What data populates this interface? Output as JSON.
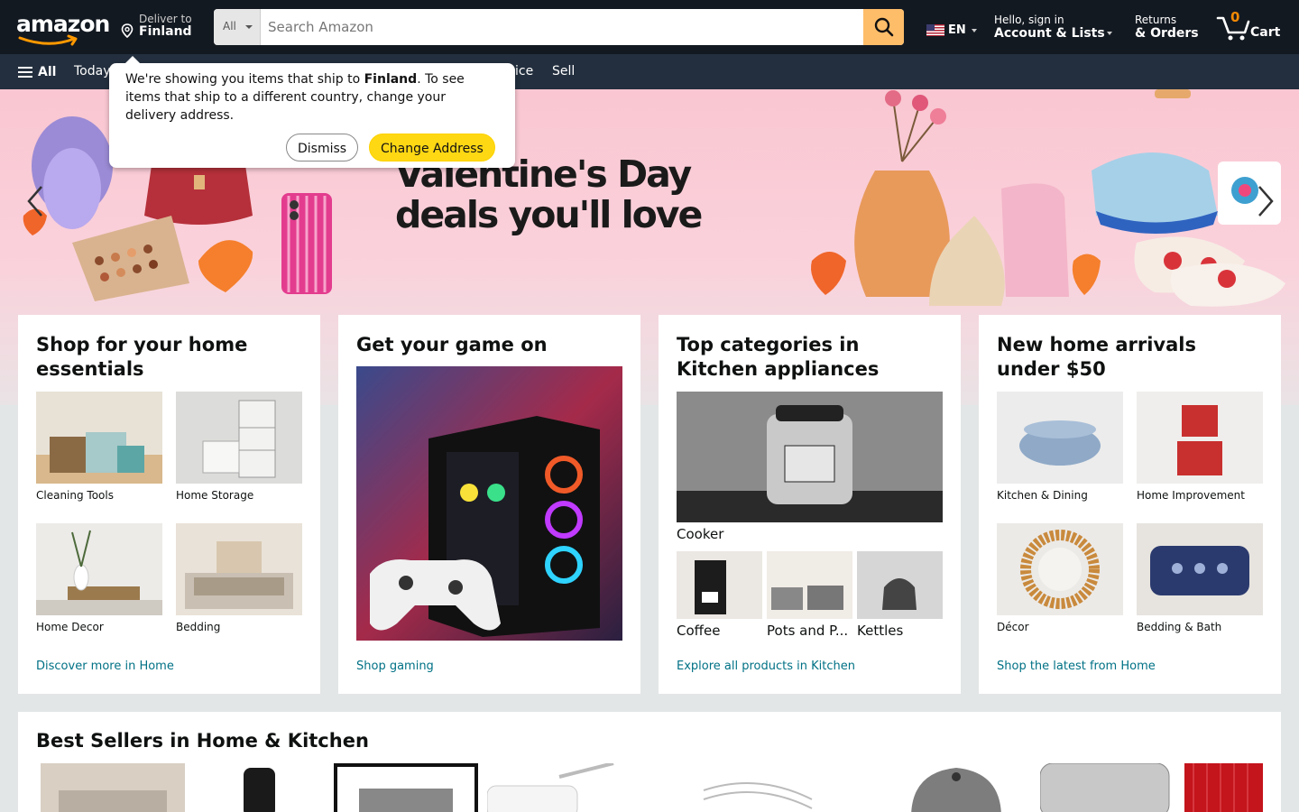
{
  "header": {
    "logo_text": "amazon",
    "deliver_line1": "Deliver to",
    "deliver_line2": "Finland",
    "search_category": "All",
    "search_placeholder": "Search Amazon",
    "language": "EN",
    "account_line1": "Hello, sign in",
    "account_line2": "Account & Lists",
    "returns_line1": "Returns",
    "returns_line2": "& Orders",
    "cart_count": "0",
    "cart_label": "Cart"
  },
  "subnav": {
    "all_label": "All",
    "links": [
      "Today",
      "ice",
      "Sell"
    ]
  },
  "popover": {
    "text_before": "We're showing you items that ship to ",
    "country": "Finland",
    "text_after": ". To see items that ship to a different country, change your delivery address.",
    "dismiss_label": "Dismiss",
    "change_label": "Change Address"
  },
  "hero": {
    "title_line1": "Valentine's Day",
    "title_line2": "deals you'll love",
    "colors": {
      "background": "#f9c6d1"
    }
  },
  "cards": [
    {
      "title": "Shop for your home essentials",
      "items": [
        "Cleaning Tools",
        "Home Storage",
        "Home Decor",
        "Bedding"
      ],
      "link": "Discover more in Home"
    },
    {
      "title": "Get your game on",
      "link": "Shop gaming"
    },
    {
      "title": "Top categories in Kitchen appliances",
      "main_item": "Cooker",
      "items": [
        "Coffee",
        "Pots and P...",
        "Kettles"
      ],
      "link": "Explore all products in Kitchen"
    },
    {
      "title": "New home arrivals under $50",
      "items": [
        "Kitchen & Dining",
        "Home Improvement",
        "Décor",
        "Bedding & Bath"
      ],
      "link": "Shop the latest from Home"
    }
  ],
  "bestsellers": {
    "title": "Best Sellers in Home & Kitchen"
  },
  "colors": {
    "nav_dark": "#131921",
    "nav_secondary": "#232f3e",
    "search_button": "#febd69",
    "accent": "#ffd814",
    "link": "#007185",
    "cart_count": "#f08804"
  }
}
